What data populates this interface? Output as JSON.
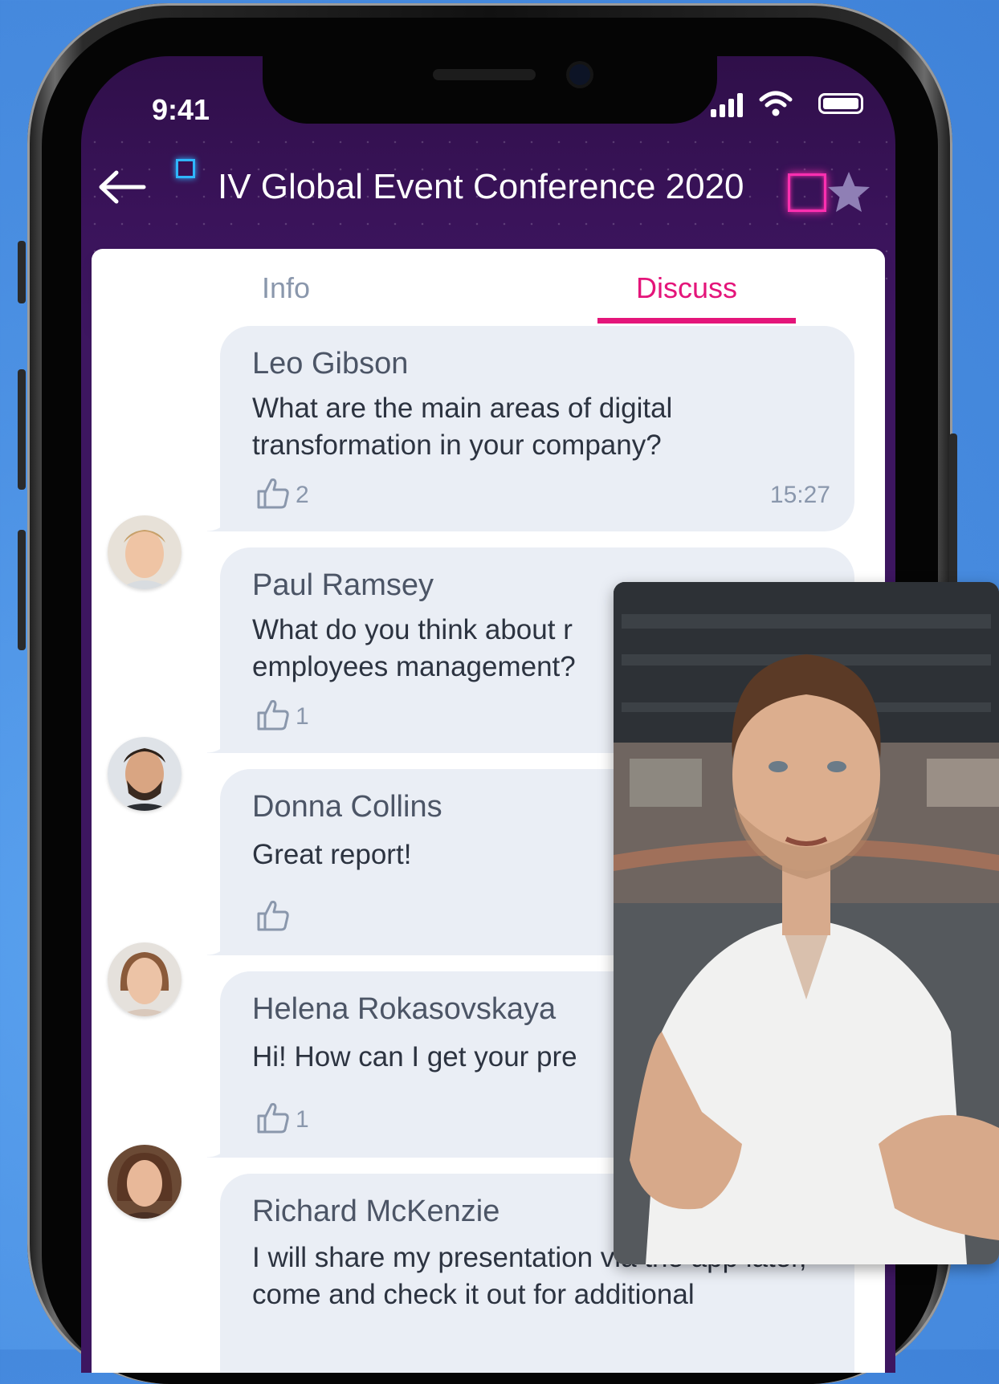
{
  "status": {
    "time": "9:41"
  },
  "header": {
    "title": "IV Global Event Conference 2020"
  },
  "tabs": [
    {
      "label": "Info",
      "active": false
    },
    {
      "label": "Discuss",
      "active": true
    }
  ],
  "colors": {
    "accent": "#e4157a",
    "header_bg": "#3a135a",
    "bubble_bg": "#eaeef5",
    "page_bg": "#4d92e4"
  },
  "messages": [
    {
      "author": "Leo Gibson",
      "text": "What are the main areas of digital transformation in your company?",
      "likes": "2",
      "time": "15:27"
    },
    {
      "author": "Paul  Ramsey",
      "text": "What do you think about r employees management?",
      "likes": "1"
    },
    {
      "author": "Donna Collins",
      "text": "Great report!",
      "likes": ""
    },
    {
      "author": "Helena Rokasovskaya",
      "text": "Hi! How can I get your pre",
      "likes": "1"
    },
    {
      "author": "Richard McKenzie",
      "text": "I will share my presentation via the app later, come and check it out for additional"
    }
  ],
  "icons": {
    "back": "arrow-left-icon",
    "favorite": "star-icon",
    "like": "thumbs-up-icon"
  }
}
